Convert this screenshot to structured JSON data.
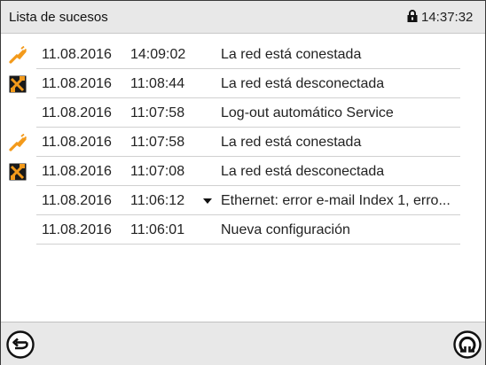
{
  "header": {
    "title": "Lista de sucesos",
    "lock_icon": "lock-icon",
    "time": "14:37:32"
  },
  "events": [
    {
      "icon": "network-connected-icon",
      "date": "11.08.2016",
      "time": "14:09:02",
      "expand": false,
      "message": "La red está conestada"
    },
    {
      "icon": "network-disconnected-icon",
      "date": "11.08.2016",
      "time": "11:08:44",
      "expand": false,
      "message": "La red está desconectada"
    },
    {
      "icon": "",
      "date": "11.08.2016",
      "time": "11:07:58",
      "expand": false,
      "message": "Log-out automático Service"
    },
    {
      "icon": "network-connected-icon",
      "date": "11.08.2016",
      "time": "11:07:58",
      "expand": false,
      "message": "La red está conestada"
    },
    {
      "icon": "network-disconnected-icon",
      "date": "11.08.2016",
      "time": "11:07:08",
      "expand": false,
      "message": "La red está desconectada"
    },
    {
      "icon": "",
      "date": "11.08.2016",
      "time": "11:06:12",
      "expand": true,
      "message": "Ethernet: error e-mail Index 1, erro..."
    },
    {
      "icon": "",
      "date": "11.08.2016",
      "time": "11:06:01",
      "expand": false,
      "message": "Nueva configuración"
    }
  ],
  "footer": {
    "back_icon": "back-arrow-icon",
    "refresh_icon": "refresh-icon"
  },
  "colors": {
    "header_bg": "#e8e8e8",
    "event_icon_orange": "#f39a1b",
    "event_icon_dark": "#1a1a1a"
  }
}
